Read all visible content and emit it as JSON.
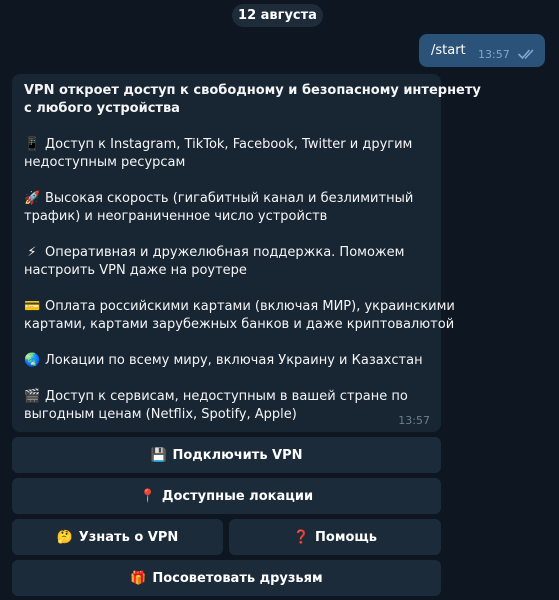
{
  "date_label": "12 августа",
  "outgoing": {
    "text": "/start",
    "time": "13:57",
    "status": "read"
  },
  "incoming": {
    "time": "13:57",
    "header_lines": [
      "VPN откроет доступ к свободному и безопасному интернету",
      "с любого устройства"
    ],
    "items": [
      {
        "icon": "mobile-phone-icon",
        "emoji": "📱",
        "lines": [
          "Доступ к Instagram, TikTok, Facebook, Twitter и другим",
          "недоступным ресурсам"
        ]
      },
      {
        "icon": "rocket-icon",
        "emoji": "🚀",
        "lines": [
          "Высокая скорость (гигабитный канал и безлимитный",
          "трафик) и неограниченное число устройств"
        ]
      },
      {
        "icon": "lightning-icon",
        "emoji": "⚡",
        "lines": [
          "Оперативная и дружелюбная поддержка. Поможем",
          "настроить VPN даже на роутере"
        ]
      },
      {
        "icon": "credit-card-icon",
        "emoji": "💳",
        "lines": [
          "Оплата российскими картами (включая МИР), украинскими",
          "картами, картами зарубежных банков и даже криптовалютой"
        ]
      },
      {
        "icon": "globe-icon",
        "emoji": "🌏",
        "lines": [
          "Локации по всему миру, включая Украину и Казахстан"
        ]
      },
      {
        "icon": "clapperboard-icon",
        "emoji": "🎬",
        "lines": [
          "Доступ к сервисам, недоступным в вашей стране по",
          "выгодным ценам (Netflix, Spotify, Apple)"
        ]
      }
    ]
  },
  "keyboard": {
    "connect": {
      "emoji": "💾",
      "icon": "floppy-disk-icon",
      "label": "Подключить VPN"
    },
    "locations": {
      "emoji": "📍",
      "icon": "pin-icon",
      "label": "Доступные локации"
    },
    "about": {
      "emoji": "🤔",
      "icon": "thinking-face-icon",
      "label": "Узнать о VPN"
    },
    "help": {
      "emoji": "❓",
      "icon": "question-mark-icon",
      "label": "Помощь"
    },
    "recommend": {
      "emoji": "🎁",
      "icon": "gift-icon",
      "label": "Посоветовать друзьям"
    }
  },
  "colors": {
    "background": "#0e1621",
    "outgoing_bubble": "#2b5278",
    "incoming_bubble": "#182533",
    "keyboard_button": "#1c2b3a",
    "read_checks": "#7da8d3"
  }
}
